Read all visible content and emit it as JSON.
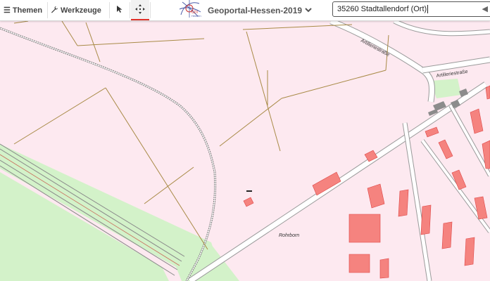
{
  "toolbar": {
    "themen_label": "Themen",
    "werkzeuge_label": "Werkzeuge",
    "portal_title": "Geoportal-Hessen-2019",
    "logo_text": "GDI-Hessen",
    "select_tool_icon": "cursor-select-icon",
    "pan_tool_icon": "move-pan-icon"
  },
  "search": {
    "value": "35260 Stadtallendorf (Ort)"
  },
  "map": {
    "labels": {
      "street_1": "Artilleriestraße",
      "street_2": "Artilleriestraße",
      "place": "Rohrborn"
    },
    "colors": {
      "background": "#fde9f0",
      "green_area": "#d3f2c9",
      "building": "#f5837f",
      "road": "#ffffff",
      "road_edge": "#9a9a9a",
      "boundary": "#a88a46"
    }
  }
}
